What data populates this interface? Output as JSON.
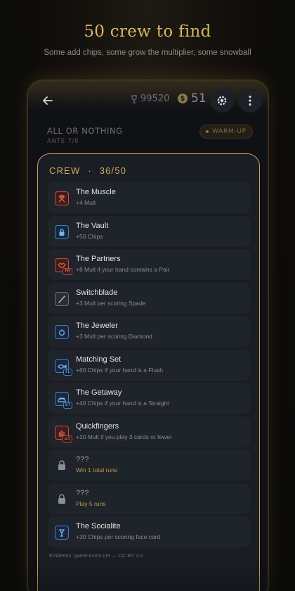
{
  "promo": {
    "headline": "50 crew to find",
    "subline": "Some add chips, some grow the multiplier, some snowball"
  },
  "topbar": {
    "score": "99520",
    "coins": "51",
    "coin_symbol": "$",
    "back_icon": "back-arrow-icon",
    "score_icon": "trophy-icon",
    "settings_icon": "gear-icon",
    "more_icon": "kebab-menu-icon"
  },
  "mode": {
    "title": "ALL OR NOTHING",
    "ante": "ANTE 7/8",
    "badge": "WARM-UP"
  },
  "crew": {
    "label": "CREW",
    "separator": "·",
    "count": "36/50",
    "items": [
      {
        "name": "The Muscle",
        "desc": "+4 Mult",
        "style": "red",
        "icon": "crossed-arms-icon",
        "tag": ""
      },
      {
        "name": "The Vault",
        "desc": "+50 Chips",
        "style": "blue",
        "icon": "padlock-icon",
        "tag": ""
      },
      {
        "name": "The Partners",
        "desc": "+8 Mult if your hand contains a Pair",
        "style": "red",
        "icon": "handshake-icon",
        "tag": "PR"
      },
      {
        "name": "Switchblade",
        "desc": "+3 Mult per scoring Spade",
        "style": "gray",
        "icon": "blade-icon",
        "tag": ""
      },
      {
        "name": "The Jeweler",
        "desc": "+3 Mult per scoring Diamond",
        "style": "blue",
        "icon": "ring-icon",
        "tag": ""
      },
      {
        "name": "Matching Set",
        "desc": "+60 Chips if your hand is a Flush",
        "style": "blue",
        "icon": "fish-icon",
        "tag": "FL"
      },
      {
        "name": "The Getaway",
        "desc": "+40 Chips if your hand is a Straight",
        "style": "blue",
        "icon": "car-icon",
        "tag": "ST"
      },
      {
        "name": "Quickfingers",
        "desc": "+20 Mult if you play 3 cards or fewer",
        "style": "red",
        "icon": "hand-icon",
        "tag": "≤3"
      },
      {
        "name": "???",
        "desc": "Win 1 total runs",
        "style": "locked",
        "icon": "lock-icon",
        "tag": ""
      },
      {
        "name": "???",
        "desc": "Play 5 runs",
        "style": "locked",
        "icon": "lock-icon",
        "tag": ""
      },
      {
        "name": "The Socialite",
        "desc": "+30 Chips per scoring face card",
        "style": "blue",
        "icon": "glass-icon",
        "tag": ""
      }
    ]
  },
  "credit": "Emblems: game-icons.net — CC BY 3.0",
  "colors": {
    "accent_gold": "#d4ad57",
    "mult_red": "#c0503b",
    "chips_blue": "#3f7fc0",
    "sheet_bg": "#1a1d24"
  }
}
